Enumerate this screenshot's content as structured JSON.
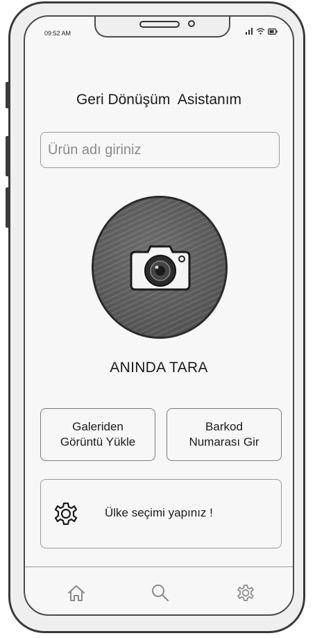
{
  "status_bar": {
    "time": "09:52 AM",
    "icons": [
      "signal-icon",
      "wifi-icon",
      "battery-icon"
    ]
  },
  "header": {
    "title": "Geri Dönüşüm  Asistanım"
  },
  "search": {
    "placeholder": "Ürün adı giriniz",
    "value": ""
  },
  "scan": {
    "icon": "camera-icon",
    "label": "ANINDA TARA"
  },
  "actions": {
    "gallery_label": "Galeriden\nGörüntü Yükle",
    "barcode_label": "Barkod\nNumarası Gir"
  },
  "country": {
    "icon": "gear-icon",
    "label": "Ülke seçimi yapınız !"
  },
  "bottom_nav": {
    "items": [
      {
        "icon": "home-icon"
      },
      {
        "icon": "search-icon"
      },
      {
        "icon": "gear-icon"
      }
    ]
  },
  "colors": {
    "ink": "#1d1d1d",
    "frame": "#3a3a3a",
    "scan_fill": "#5b5b5b",
    "screen_bg": "#f7f7f7"
  }
}
